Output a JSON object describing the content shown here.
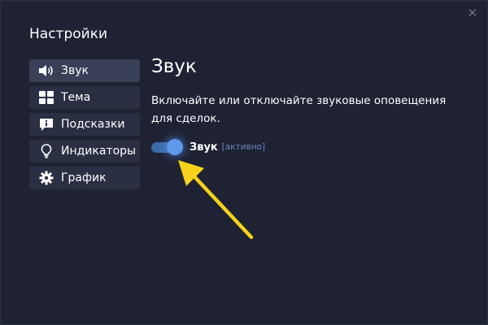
{
  "dialog": {
    "title": "Настройки",
    "close_icon": "close-icon"
  },
  "sidebar": {
    "items": [
      {
        "label": "Звук",
        "icon": "speaker-icon",
        "active": true
      },
      {
        "label": "Тема",
        "icon": "grid-icon",
        "active": false
      },
      {
        "label": "Подсказки",
        "icon": "info-icon",
        "active": false
      },
      {
        "label": "Индикаторы",
        "icon": "lightbulb-icon",
        "active": false
      },
      {
        "label": "График",
        "icon": "gear-icon",
        "active": false
      }
    ]
  },
  "content": {
    "title": "Звук",
    "description": "Включайте или отключайте звуковые оповещения для сделок.",
    "toggle": {
      "label": "Звук",
      "status": "[активно]",
      "on": true
    }
  },
  "colors": {
    "background": "#1e2233",
    "accent": "#5f98ea",
    "arrow": "#f7d21a"
  }
}
